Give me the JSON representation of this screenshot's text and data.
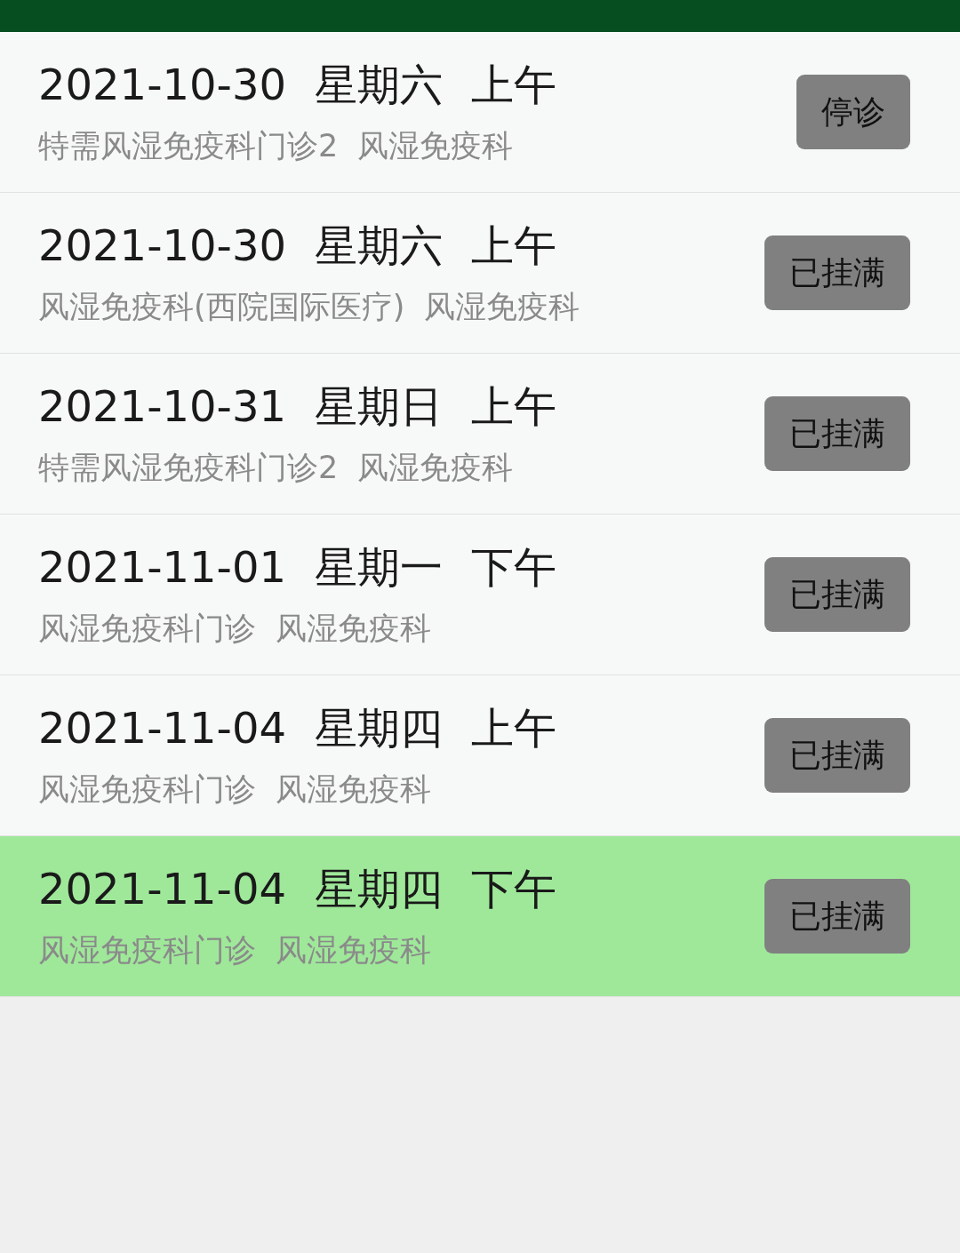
{
  "slots": [
    {
      "date": "2021-10-30",
      "weekday": "星期六",
      "period": "上午",
      "clinic": "特需风湿免疫科门诊2",
      "department": "风湿免疫科",
      "status": "停诊",
      "selected": false
    },
    {
      "date": "2021-10-30",
      "weekday": "星期六",
      "period": "上午",
      "clinic": "风湿免疫科(西院国际医疗)",
      "department": "风湿免疫科",
      "status": "已挂满",
      "selected": false
    },
    {
      "date": "2021-10-31",
      "weekday": "星期日",
      "period": "上午",
      "clinic": "特需风湿免疫科门诊2",
      "department": "风湿免疫科",
      "status": "已挂满",
      "selected": false
    },
    {
      "date": "2021-11-01",
      "weekday": "星期一",
      "period": "下午",
      "clinic": "风湿免疫科门诊",
      "department": "风湿免疫科",
      "status": "已挂满",
      "selected": false
    },
    {
      "date": "2021-11-04",
      "weekday": "星期四",
      "period": "上午",
      "clinic": "风湿免疫科门诊",
      "department": "风湿免疫科",
      "status": "已挂满",
      "selected": false
    },
    {
      "date": "2021-11-04",
      "weekday": "星期四",
      "period": "下午",
      "clinic": "风湿免疫科门诊",
      "department": "风湿免疫科",
      "status": "已挂满",
      "selected": true
    }
  ]
}
